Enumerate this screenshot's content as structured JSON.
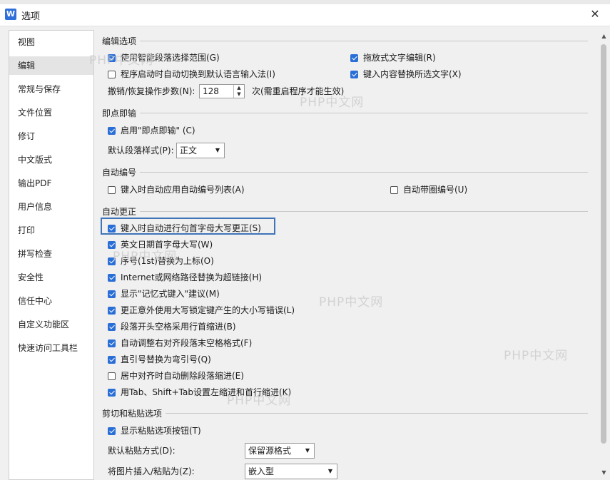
{
  "window": {
    "title": "选项",
    "app_icon_letter": "W",
    "close_glyph": "✕"
  },
  "sidebar": {
    "items": [
      {
        "label": "视图"
      },
      {
        "label": "编辑"
      },
      {
        "label": "常规与保存"
      },
      {
        "label": "文件位置"
      },
      {
        "label": "修订"
      },
      {
        "label": "中文版式"
      },
      {
        "label": "输出PDF"
      },
      {
        "label": "用户信息"
      },
      {
        "label": "打印"
      },
      {
        "label": "拼写检查"
      },
      {
        "label": "安全性"
      },
      {
        "label": "信任中心"
      },
      {
        "label": "自定义功能区"
      },
      {
        "label": "快速访问工具栏"
      }
    ],
    "active_index": 1
  },
  "edit_options": {
    "title": "编辑选项",
    "smart_paragraph": {
      "label": "使用智能段落选择范围(G)",
      "checked": true
    },
    "drag_text": {
      "label": "拖放式文字编辑(R)",
      "checked": true
    },
    "auto_switch_lang": {
      "label": "程序启动时自动切换到默认语言输入法(I)",
      "checked": false
    },
    "typing_replaces": {
      "label": "键入内容替换所选文字(X)",
      "checked": true
    },
    "undo_steps": {
      "label": "撤销/恢复操作步数(N):",
      "value": "128",
      "suffix": "次(需重启程序才能生效)"
    }
  },
  "click_type": {
    "title": "即点即输",
    "enable": {
      "label": "启用\"即点即输\" (C)",
      "checked": true
    },
    "default_style": {
      "label": "默认段落样式(P):",
      "value": "正文"
    }
  },
  "auto_numbering": {
    "title": "自动编号",
    "auto_list": {
      "label": "键入时自动应用自动编号列表(A)",
      "checked": false
    },
    "auto_circle": {
      "label": "自动带圈编号(U)",
      "checked": false
    }
  },
  "autocorrect": {
    "title": "自动更正",
    "items": [
      {
        "label": "键入时自动进行句首字母大写更正(S)",
        "checked": true
      },
      {
        "label": "英文日期首字母大写(W)",
        "checked": true
      },
      {
        "label": "序号(1st)替换为上标(O)",
        "checked": true
      },
      {
        "label": "Internet或网络路径替换为超链接(H)",
        "checked": true
      },
      {
        "label": "显示\"记忆式键入\"建议(M)",
        "checked": true
      },
      {
        "label": "更正意外使用大写锁定键产生的大小写错误(L)",
        "checked": true
      },
      {
        "label": "段落开头空格采用行首缩进(B)",
        "checked": true
      },
      {
        "label": "自动调整右对齐段落末空格格式(F)",
        "checked": true
      },
      {
        "label": "直引号替换为弯引号(Q)",
        "checked": true
      },
      {
        "label": "居中对齐时自动删除段落缩进(E)",
        "checked": false
      },
      {
        "label": "用Tab、Shift+Tab设置左缩进和首行缩进(K)",
        "checked": true
      }
    ]
  },
  "paste": {
    "title": "剪切和粘贴选项",
    "show_button": {
      "label": "显示粘贴选项按钮(T)",
      "checked": true
    },
    "default_paste": {
      "label": "默认粘贴方式(D):",
      "value": "保留源格式"
    },
    "picture_insert": {
      "label": "将图片插入/粘贴为(Z):",
      "value": "嵌入型"
    }
  },
  "watermark_text": "PHP中文网",
  "colors": {
    "accent": "#2a6fd6",
    "highlight_border": "#3f74b8",
    "sidebar_active": "#e4e4e4"
  }
}
